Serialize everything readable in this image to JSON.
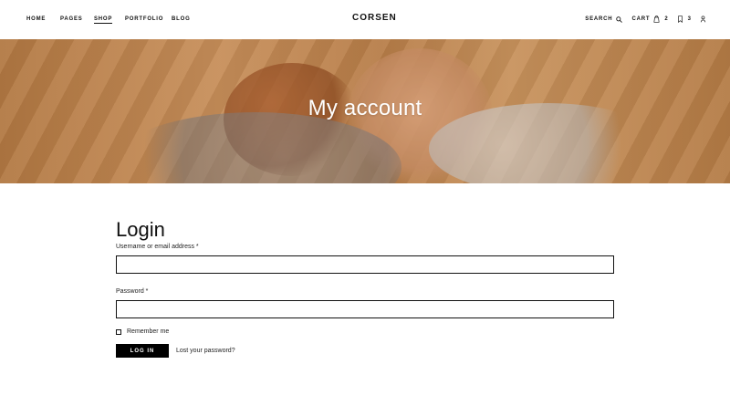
{
  "header": {
    "nav": {
      "home": "HOME",
      "pages": "PAGES",
      "shop": "SHOP",
      "portfolio": "PORTFOLIO",
      "blog": "BLOG"
    },
    "logo": "CORSEN",
    "search_label": "SEARCH",
    "cart_label": "CART",
    "cart_count": "2",
    "wishlist_count": "3"
  },
  "hero": {
    "title": "My account"
  },
  "login": {
    "title": "Login",
    "username_label": "Username or email address *",
    "password_label": "Password *",
    "remember_label": "Remember me",
    "submit_label": "LOG IN",
    "lost_password": "Lost your password?"
  },
  "icons": {
    "search": "search-icon",
    "cart": "cart-icon",
    "wishlist": "bookmark-icon",
    "user": "user-icon"
  }
}
